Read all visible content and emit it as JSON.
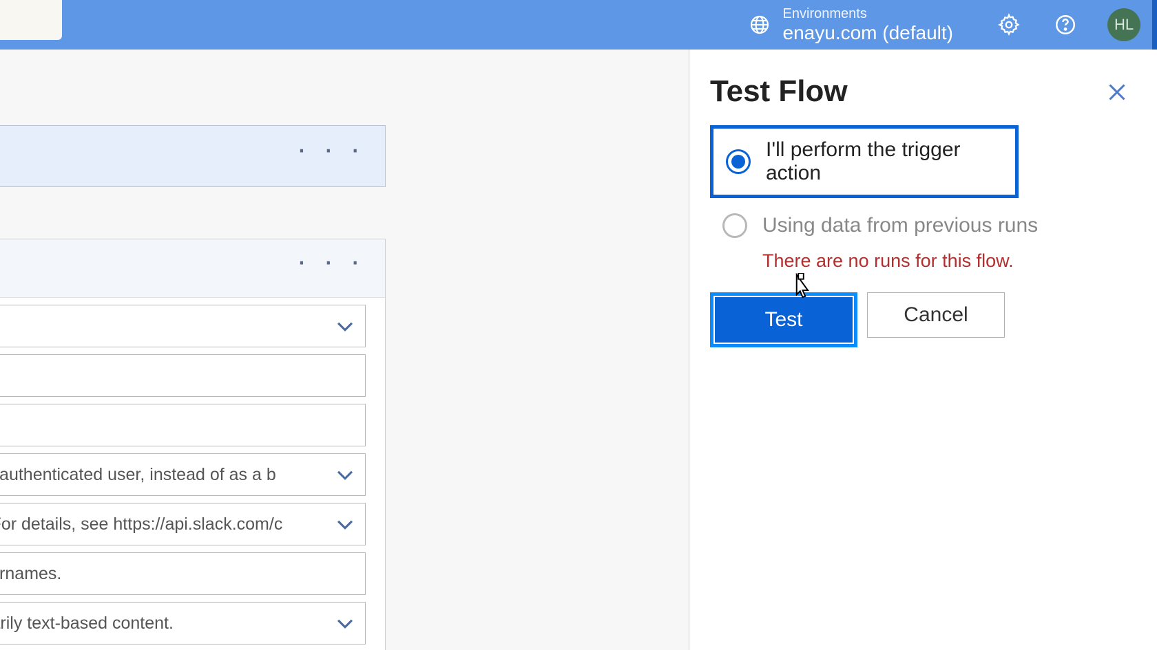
{
  "header": {
    "env_label": "Environments",
    "env_name": "enayu.com (default)",
    "avatar_initials": "HL"
  },
  "canvas": {
    "fields": [
      {
        "text": "",
        "has_chevron": true
      },
      {
        "text": "",
        "has_chevron": false
      },
      {
        "text": "",
        "has_chevron": false
      },
      {
        "text": "as the authenticated user, instead of as a b",
        "has_chevron": true
      },
      {
        "text": "ated. For details, see https://api.slack.com/c",
        "has_chevron": true
      },
      {
        "text": "nd usernames.",
        "has_chevron": false
      },
      {
        "text": "f primarily text-based content.",
        "has_chevron": true
      }
    ]
  },
  "panel": {
    "title": "Test Flow",
    "option_manual": "I'll perform the trigger action",
    "option_previous": "Using data from previous runs",
    "no_runs_msg": "There are no runs for this flow.",
    "test_label": "Test",
    "cancel_label": "Cancel"
  }
}
